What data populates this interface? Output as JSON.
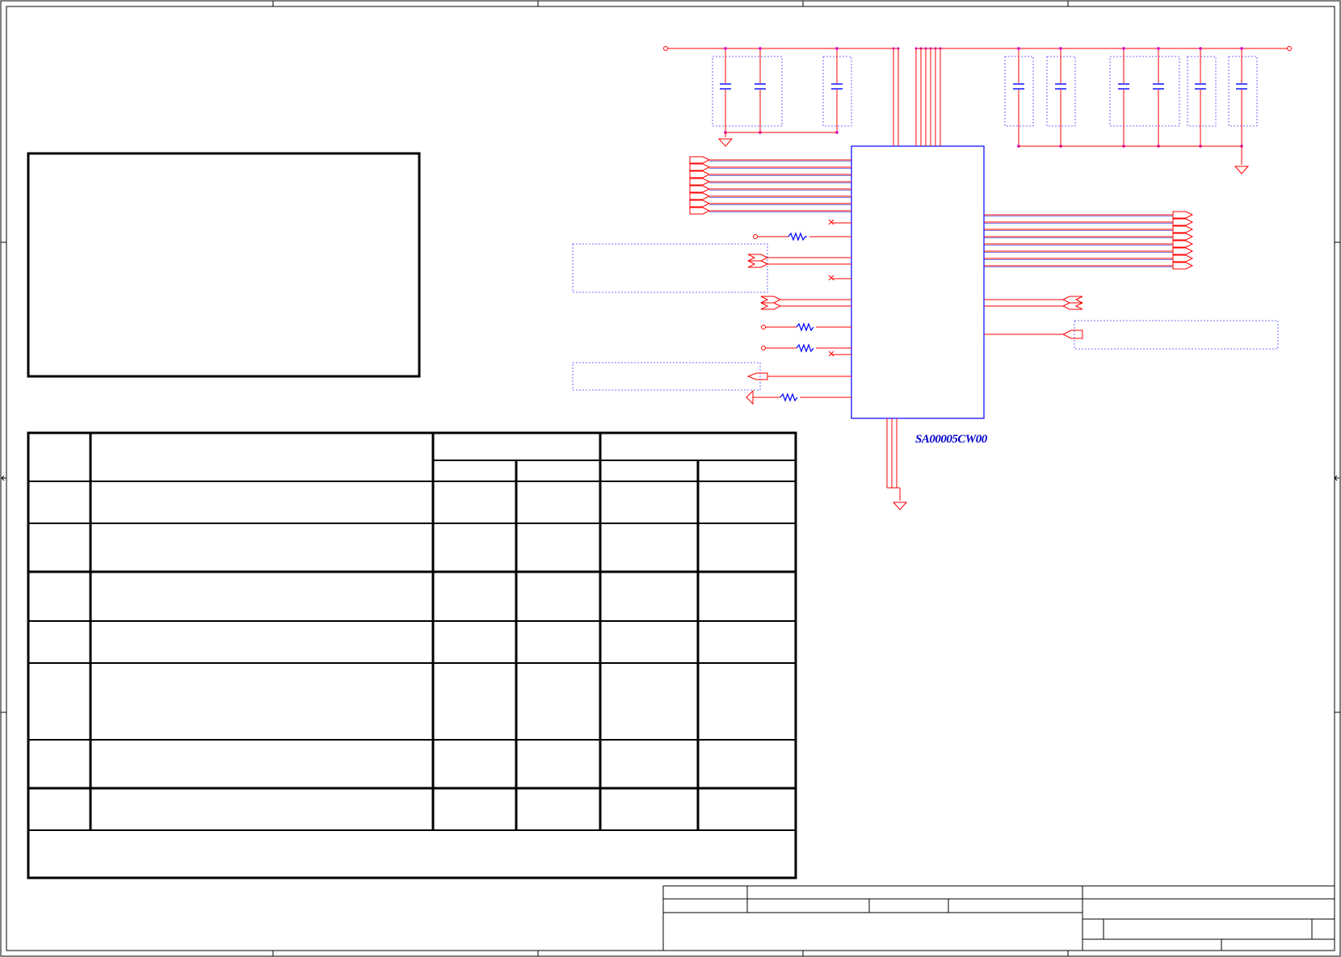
{
  "schematic": {
    "part_number": "SA00005CW00"
  },
  "colors": {
    "wire": "#ff0000",
    "component": "#0000ff",
    "net_dot": "#cc00cc",
    "frame": "#000000",
    "group_box": "#3333ff",
    "power_flag": "#ff0000"
  },
  "icons": {
    "power_rail_port": "open-circle",
    "ground": "ground-triangle",
    "capacitor": "capacitor-symbol",
    "resistor": "resistor-zigzag",
    "offpage_connector": "arrow-connector",
    "no_connect": "x-mark"
  }
}
